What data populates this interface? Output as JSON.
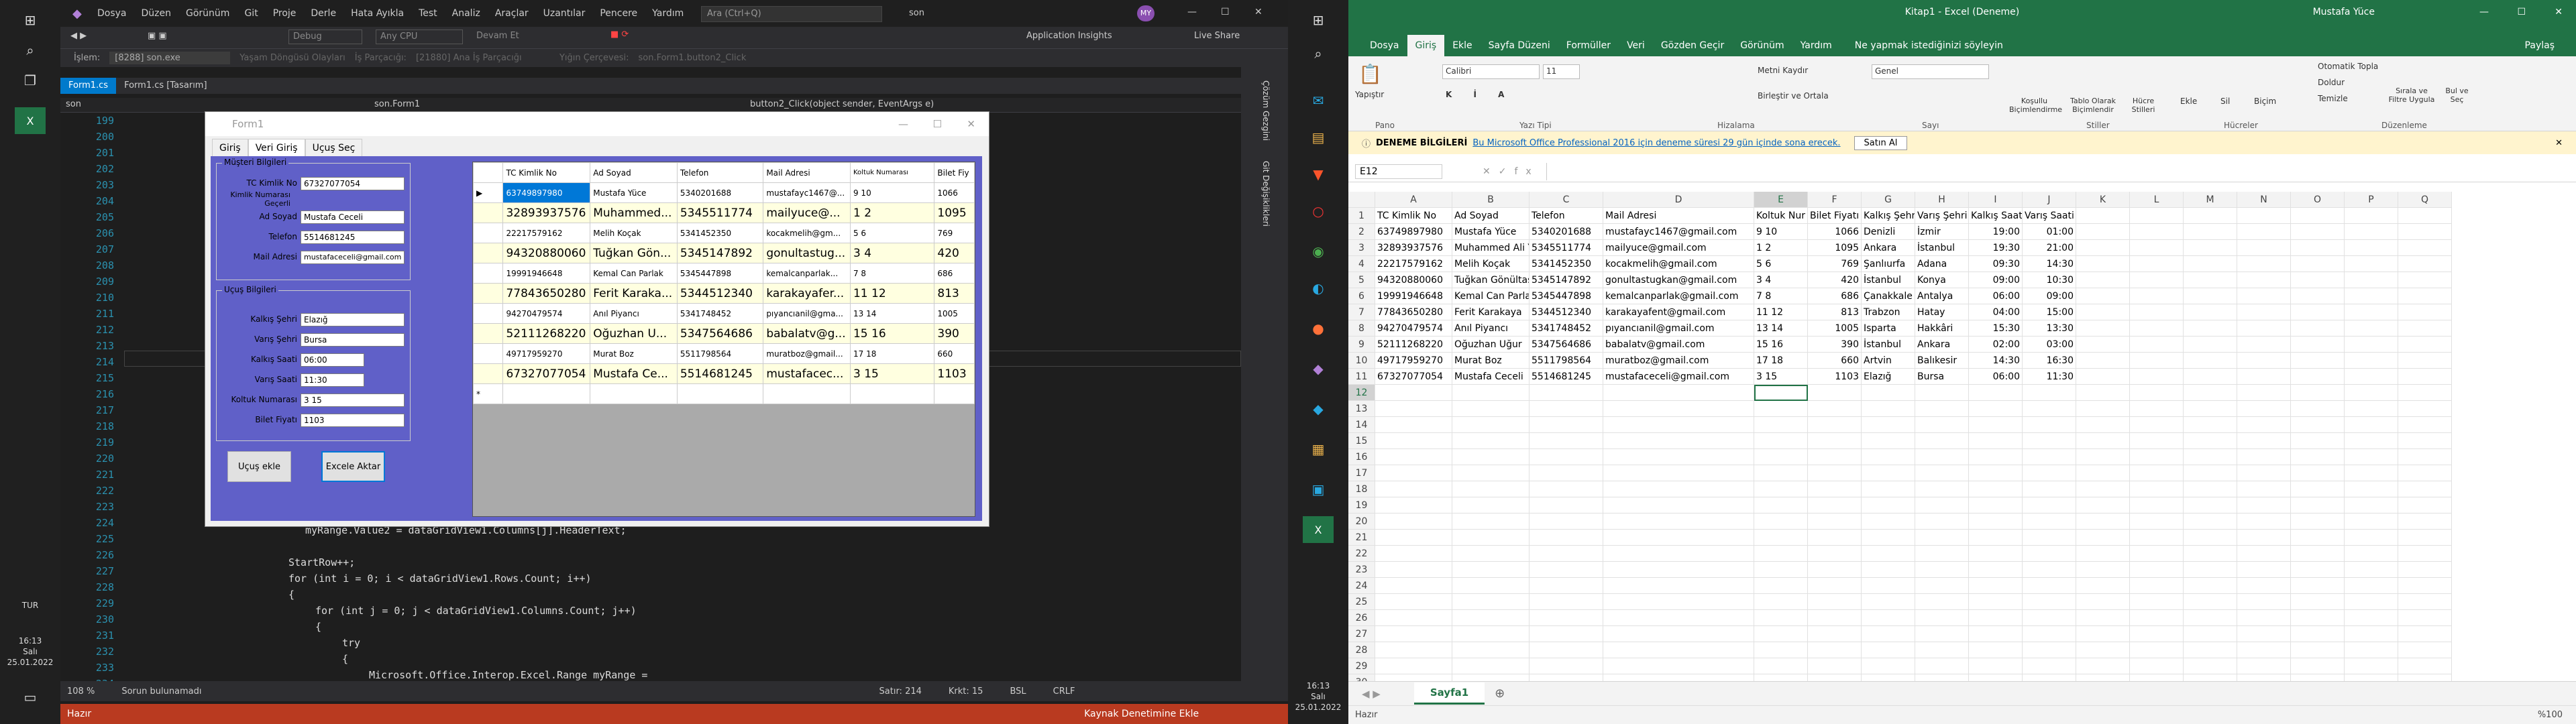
{
  "taskbar_left": {
    "lang": "TUR",
    "time": "16:13",
    "day": "Salı",
    "date": "25.01.2022"
  },
  "taskbar_right": {
    "time": "16:13",
    "day": "Salı",
    "date": "25.01.2022"
  },
  "vs": {
    "menu": [
      "Dosya",
      "Düzen",
      "Görünüm",
      "Git",
      "Proje",
      "Derle",
      "Hata Ayıkla",
      "Test",
      "Analiz",
      "Araçlar",
      "Uzantılar",
      "Pencere",
      "Yardım"
    ],
    "search_placeholder": "Ara (Ctrl+Q)",
    "solution": "son",
    "user_badge": "MY",
    "toolbar": {
      "debug": "Debug",
      "cpu": "Any CPU",
      "continue": "Devam Et",
      "app_insights": "Application Insights",
      "live_share": "Live Share"
    },
    "info": {
      "process_label": "İşlem:",
      "process": "[8288] son.exe",
      "lifecycle": "Yaşam Döngüsü Olayları",
      "thread": "İş Parçacığı:",
      "thread_val": "[21880] Ana İş Parçacığı",
      "stack": "Yığın Çerçevesi:",
      "stack_val": "son.Form1.button2_Click"
    },
    "tabs": [
      "Form1.cs",
      "Form1.cs [Tasarım]"
    ],
    "nav": {
      "project": "son",
      "class": "son.Form1",
      "member": "button2_Click(object sender, EventArgs e)"
    },
    "side_labels": [
      "Çözüm Gezgini",
      "Git Değişiklikleri"
    ],
    "line_numbers": [
      "199",
      "200",
      "201",
      "202",
      "203",
      "204",
      "205",
      "206",
      "207",
      "208",
      "209",
      "210",
      "211",
      "212",
      "213",
      "214",
      "215",
      "216",
      "217",
      "218",
      "219",
      "220",
      "221",
      "222",
      "223",
      "224",
      "225",
      "226",
      "227",
      "228",
      "229",
      "230",
      "231",
      "232",
      "233",
      "234"
    ],
    "code": {
      "l226": "myRange.Value2 = dataGridView1.Columns[j].HeaderText;",
      "l228": "StartRow++;",
      "l229": "for (int i = 0; i < dataGridView1.Rows.Count; i++)",
      "l230": "{",
      "l231": "for (int j = 0; j < dataGridView1.Columns.Count; j++)",
      "l232": "{",
      "l233": "try",
      "l234": "{",
      "l235": "Microsoft.Office.Interop.Excel.Range myRange ="
    },
    "bottom": {
      "zoom": "108 %",
      "issues": "Sorun bulunamadı",
      "line": "Satır: 214",
      "char": "Krkt: 15",
      "tab": "BSL",
      "eol": "CRLF"
    },
    "status": {
      "ready": "Hazır",
      "source_control": "Kaynak Denetimine Ekle"
    }
  },
  "form": {
    "title": "Form1",
    "tabs": [
      "Giriş",
      "Veri Giriş",
      "Uçuş Seç"
    ],
    "group_customer": "Müşteri Bilgileri",
    "group_flight": "Uçuş Bilgileri",
    "fields": {
      "tc_label": "TC Kimlik No",
      "tc": "67327077054",
      "tc_warn": "Kimlik Numarası Geçerli",
      "name_label": "Ad Soyad",
      "name": "Mustafa Ceceli",
      "phone_label": "Telefon",
      "phone": "5514681245",
      "mail_label": "Mail Adresi",
      "mail": "mustafaceceli@gmail.com",
      "from_label": "Kalkış Şehri",
      "from": "Elazığ",
      "to_label": "Varış Şehri",
      "to": "Bursa",
      "dep_label": "Kalkış Saati",
      "dep": "06:00",
      "arr_label": "Varış Saati",
      "arr": "11:30",
      "seat_label": "Koltuk Numarası",
      "seat": "3 15",
      "price_label": "Bilet Fiyatı",
      "price": "1103"
    },
    "buttons": {
      "add": "Uçuş ekle",
      "export": "Excele Aktar"
    },
    "grid_headers": [
      "TC Kimlik No",
      "Ad Soyad",
      "Telefon",
      "Mail Adresi",
      "Koltuk Numarası",
      "Bilet Fiy"
    ],
    "grid_rows": [
      [
        "63749897980",
        "Mustafa Yüce",
        "5340201688",
        "mustafayc1467@...",
        "9  10",
        "1066"
      ],
      [
        "32893937576",
        "Muhammed...",
        "5345511774",
        "mailyuce@...",
        "1  2",
        "1095"
      ],
      [
        "22217579162",
        "Melih Koçak",
        "5341452350",
        "kocakmelih@gm...",
        "5  6",
        "769"
      ],
      [
        "94320880060",
        "Tuğkan Gön...",
        "5345147892",
        "gonultastug...",
        "3  4",
        "420"
      ],
      [
        "19991946648",
        "Kemal Can Parlak",
        "5345447898",
        "kemalcanparlak...",
        "7  8",
        "686"
      ],
      [
        "77843650280",
        "Ferit Karaka...",
        "5344512340",
        "karakayafer...",
        "11  12",
        "813"
      ],
      [
        "94270479574",
        "Anıl Piyancı",
        "5341748452",
        "pıyancıanil@gma...",
        "13  14",
        "1005"
      ],
      [
        "52111268220",
        "Oğuzhan U...",
        "5347564686",
        "babalatv@g...",
        "15  16",
        "390"
      ],
      [
        "49717959270",
        "Murat Boz",
        "5511798564",
        "muratboz@gmail...",
        "17  18",
        "660"
      ],
      [
        "67327077054",
        "Mustafa Ce...",
        "5514681245",
        "mustafacec...",
        "3  15",
        "1103"
      ]
    ]
  },
  "excel": {
    "title": "Kitap1 - Excel (Deneme)",
    "user": "Mustafa Yüce",
    "tabs": [
      "Dosya",
      "Giriş",
      "Ekle",
      "Sayfa Düzeni",
      "Formüller",
      "Veri",
      "Gözden Geçir",
      "Görünüm",
      "Yardım"
    ],
    "tell_me": "Ne yapmak istediğinizi söyleyin",
    "share": "Paylaş",
    "ribbon": {
      "paste": "Yapıştır",
      "clipboard": "Pano",
      "font": "Calibri",
      "size": "11",
      "font_group": "Yazı Tipi",
      "wrap": "Metni Kaydır",
      "merge": "Birleştir ve Ortala",
      "align_group": "Hizalama",
      "number_fmt": "Genel",
      "number_group": "Sayı",
      "cond": "Koşullu Biçimlendirme",
      "table": "Tablo Olarak Biçimlendir",
      "styles": "Hücre Stilleri",
      "styles_group": "Stiller",
      "insert": "Ekle",
      "delete": "Sil",
      "format": "Biçim",
      "cells_group": "Hücreler",
      "autosum": "Otomatik Topla",
      "fill": "Doldur",
      "clear": "Temizle",
      "sort": "Sırala ve Filtre Uygula",
      "find": "Bul ve Seç",
      "edit_group": "Düzenleme"
    },
    "warning": {
      "label": "DENEME BİLGİLERİ",
      "text": "Bu Microsoft Office Professional 2016 için deneme süresi 29 gün içinde sona erecek.",
      "button": "Satın Al"
    },
    "name_box": "E12",
    "columns": [
      "A",
      "B",
      "C",
      "D",
      "E",
      "F",
      "G",
      "H",
      "I",
      "J",
      "K",
      "L",
      "M",
      "N",
      "O",
      "P",
      "Q"
    ],
    "rows": [
      [
        "TC Kimlik No",
        "Ad Soyad",
        "Telefon",
        "Mail Adresi",
        "Koltuk Nur",
        "Bilet Fiyatı",
        "Kalkış Şehri",
        "Varış Şehri",
        "Kalkış Saati",
        "Varış Saati"
      ],
      [
        "63749897980",
        "Mustafa Yüce",
        "5340201688",
        "mustafayc1467@gmail.com",
        "9  10",
        "1066",
        "Denizli",
        "İzmir",
        "19:00",
        "01:00"
      ],
      [
        "32893937576",
        "Muhammed Ali Yüce",
        "5345511774",
        "mailyuce@gmail.com",
        "1  2",
        "1095",
        "Ankara",
        "İstanbul",
        "19:30",
        "21:00"
      ],
      [
        "22217579162",
        "Melih Koçak",
        "5341452350",
        "kocakmelih@gmail.com",
        "5  6",
        "769",
        "Şanlıurfa",
        "Adana",
        "09:30",
        "14:30"
      ],
      [
        "94320880060",
        "Tuğkan Gönültaş",
        "5345147892",
        "gonultastugkan@gmail.com",
        "3  4",
        "420",
        "İstanbul",
        "Konya",
        "09:00",
        "10:30"
      ],
      [
        "19991946648",
        "Kemal Can Parlak",
        "5345447898",
        "kemalcanparlak@gmail.com",
        "7  8",
        "686",
        "Çanakkale",
        "Antalya",
        "06:00",
        "09:00"
      ],
      [
        "77843650280",
        "Ferit Karakaya",
        "5344512340",
        "karakayafent@gmail.com",
        "11  12",
        "813",
        "Trabzon",
        "Hatay",
        "04:00",
        "15:00"
      ],
      [
        "94270479574",
        "Anıl Piyancı",
        "5341748452",
        "pıyancıanil@gmail.com",
        "13  14",
        "1005",
        "Isparta",
        "Hakkâri",
        "15:30",
        "13:30"
      ],
      [
        "52111268220",
        "Oğuzhan Uğur",
        "5347564686",
        "babalatv@gmail.com",
        "15  16",
        "390",
        "İstanbul",
        "Ankara",
        "02:00",
        "03:00"
      ],
      [
        "49717959270",
        "Murat Boz",
        "5511798564",
        "muratboz@gmail.com",
        "17  18",
        "660",
        "Artvin",
        "Balıkesir",
        "14:30",
        "16:30"
      ],
      [
        "67327077054",
        "Mustafa Ceceli",
        "5514681245",
        "mustafaceceli@gmail.com",
        "3  15",
        "1103",
        "Elazığ",
        "Bursa",
        "06:00",
        "11:30"
      ]
    ],
    "row_numbers": [
      "1",
      "2",
      "3",
      "4",
      "5",
      "6",
      "7",
      "8",
      "9",
      "10",
      "11",
      "12",
      "13",
      "14",
      "15",
      "16",
      "17",
      "18",
      "19",
      "20",
      "21",
      "22",
      "23",
      "24",
      "25",
      "26",
      "27",
      "28",
      "29",
      "30",
      "31"
    ],
    "sheet": "Sayfa1",
    "status": {
      "ready": "Hazır",
      "zoom": "%100"
    }
  }
}
